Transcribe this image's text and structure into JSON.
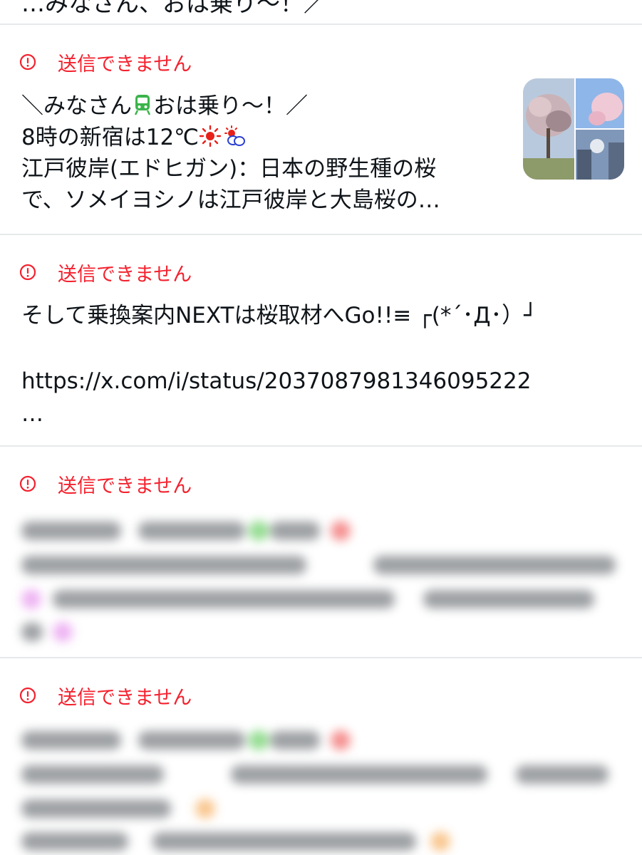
{
  "top_fragment": {
    "text": "…みなさん、おは乗り〜！／"
  },
  "messages": [
    {
      "error_label": "送信できません",
      "lines": [
        "＼みなさん",
        "おは乗り〜！／",
        "8時の新宿は12℃",
        "江戸彼岸(エドヒガン)：日本の野生種の桜",
        "で、ソメイヨシノは江戸彼岸と大島桜の…"
      ],
      "icons": [
        "train-icon",
        "sun-icon",
        "sun-behind-cloud-icon"
      ],
      "has_thumbnail": true
    },
    {
      "error_label": "送信できません",
      "lines": [
        "そして乗換案内NEXTは桜取材へGo!!≡ ┌(*´･Д･）┘",
        "",
        "https://x.com/i/status/2037087981346095222",
        "…"
      ]
    },
    {
      "error_label": "送信できません",
      "blurred": true
    },
    {
      "error_label": "送信できません",
      "blurred": true
    }
  ],
  "colors": {
    "error": "#f4212e",
    "text": "#0f1419",
    "divider": "#e6e9eb"
  }
}
